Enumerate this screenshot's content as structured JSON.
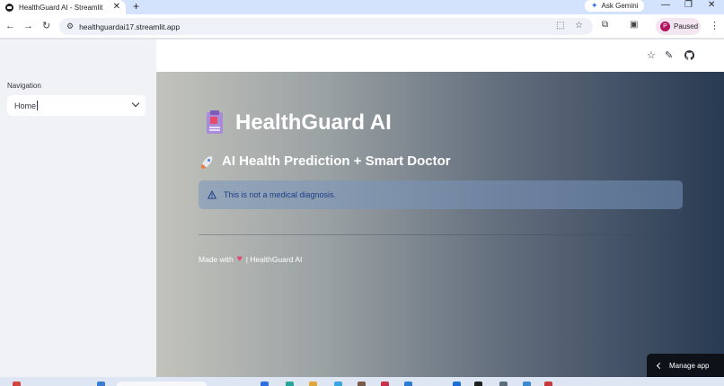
{
  "browser": {
    "tab_title": "HealthGuard AI - Streamlit",
    "new_tab": "+",
    "ask_gemini": "Ask Gemini",
    "url": "healthguardai17.streamlit.app",
    "profile_initial": "P",
    "profile_status": "Paused"
  },
  "sidebar": {
    "nav_label": "Navigation",
    "nav_selected": "Home"
  },
  "main": {
    "title": "HealthGuard AI",
    "subtitle": "AI Health Prediction + Smart Doctor",
    "alert_text": "This is not a medical diagnosis.",
    "footer_prefix": "Made with",
    "footer_suffix": "| HealthGuard AI"
  },
  "manage_app": {
    "label": "Manage app"
  },
  "colors": {
    "accent_dark": "#0e1117",
    "alert_text": "#1e3f86",
    "heart": "#e8436b"
  }
}
